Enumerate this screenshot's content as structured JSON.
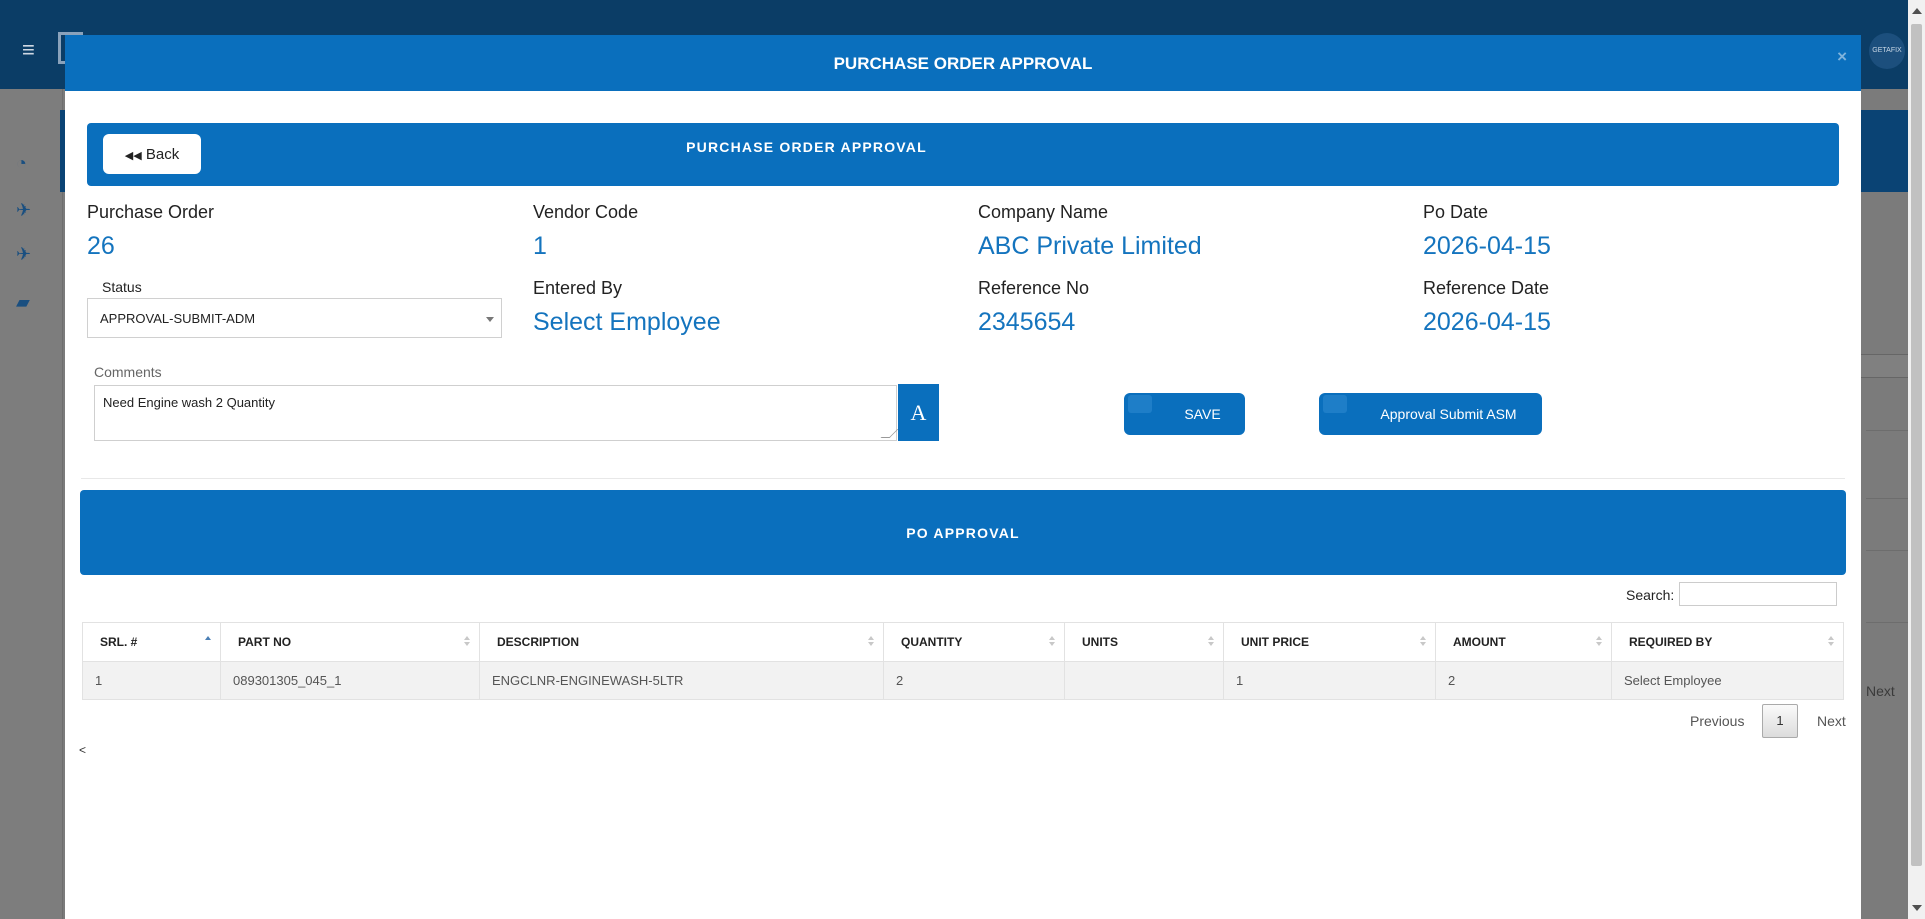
{
  "background": {
    "avatar_text": "GETAFIX",
    "next_label": "Next"
  },
  "modal": {
    "title": "PURCHASE ORDER APPROVAL",
    "close_symbol": "×"
  },
  "banner": {
    "back_label": "Back",
    "title": "PURCHASE ORDER APPROVAL"
  },
  "fields": {
    "purchase_order": {
      "label": "Purchase Order",
      "value": "26"
    },
    "vendor_code": {
      "label": "Vendor Code",
      "value": "1"
    },
    "company_name": {
      "label": "Company Name",
      "value": "ABC Private Limited"
    },
    "po_date": {
      "label": "Po Date",
      "value": "2026-04-15"
    },
    "entered_by": {
      "label": "Entered By",
      "value": "Select Employee"
    },
    "reference_no": {
      "label": "Reference No",
      "value": "2345654"
    },
    "reference_date": {
      "label": "Reference Date",
      "value": "2026-04-15"
    }
  },
  "status": {
    "label": "Status",
    "value": "APPROVAL-SUBMIT-ADM"
  },
  "comments": {
    "label": "Comments",
    "value": "Need Engine wash 2 Quantity",
    "font_button": "A"
  },
  "actions": {
    "save_label": "SAVE",
    "approval_label": "Approval Submit ASM"
  },
  "po_section": {
    "title": "PO APPROVAL",
    "search_label": "Search:",
    "columns": [
      "SRL. #",
      "PART NO",
      "DESCRIPTION",
      "QUANTITY",
      "UNITS",
      "UNIT PRICE",
      "AMOUNT",
      "REQUIRED BY"
    ],
    "rows": [
      [
        "1",
        "089301305_045_1",
        "ENGCLNR-ENGINEWASH-5LTR",
        "2",
        "",
        "1",
        "2",
        "Select Employee"
      ]
    ],
    "pagination": {
      "previous": "Previous",
      "page": "1",
      "next": "Next"
    },
    "footer_symbol": "<"
  },
  "colors": {
    "primary": "#0a6fbd",
    "value_text": "#1474be"
  }
}
